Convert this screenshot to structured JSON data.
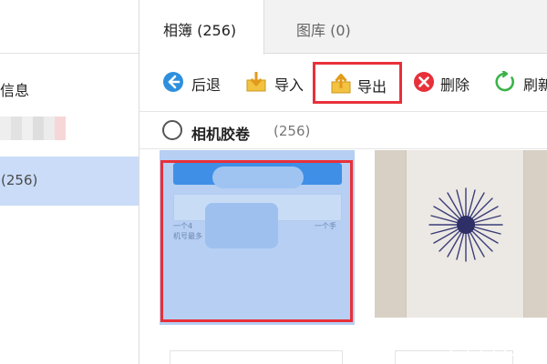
{
  "sidebar": {
    "items": [
      {
        "label": "信息"
      },
      {
        "label": ""
      },
      {
        "label": "(256)"
      }
    ]
  },
  "tabs": [
    {
      "label": "相簿 (256)",
      "active": true
    },
    {
      "label": "图库 (0)",
      "active": false
    }
  ],
  "toolbar": {
    "back_label": "后退",
    "import_label": "导入",
    "export_label": "导出",
    "delete_label": "删除",
    "refresh_label": "刷新"
  },
  "camera_roll": {
    "label": "相机胶卷",
    "count": "(256)"
  },
  "photos": [
    {
      "icon": "blurred-phone-screenshot",
      "selected": true,
      "caption_left": "一个4",
      "caption_right": "一个手",
      "caption_line2": "机号最多"
    },
    {
      "icon": "sea-urchin-phone-photo",
      "selected": false
    }
  ],
  "colors": {
    "accent_red": "#e8303a",
    "selection_blue": "#cadcf7",
    "back_icon_blue": "#2e8fde",
    "delete_icon_red": "#e8303a",
    "refresh_icon_green": "#3bb34a",
    "folder_icon_yellow": "#f2c240"
  }
}
